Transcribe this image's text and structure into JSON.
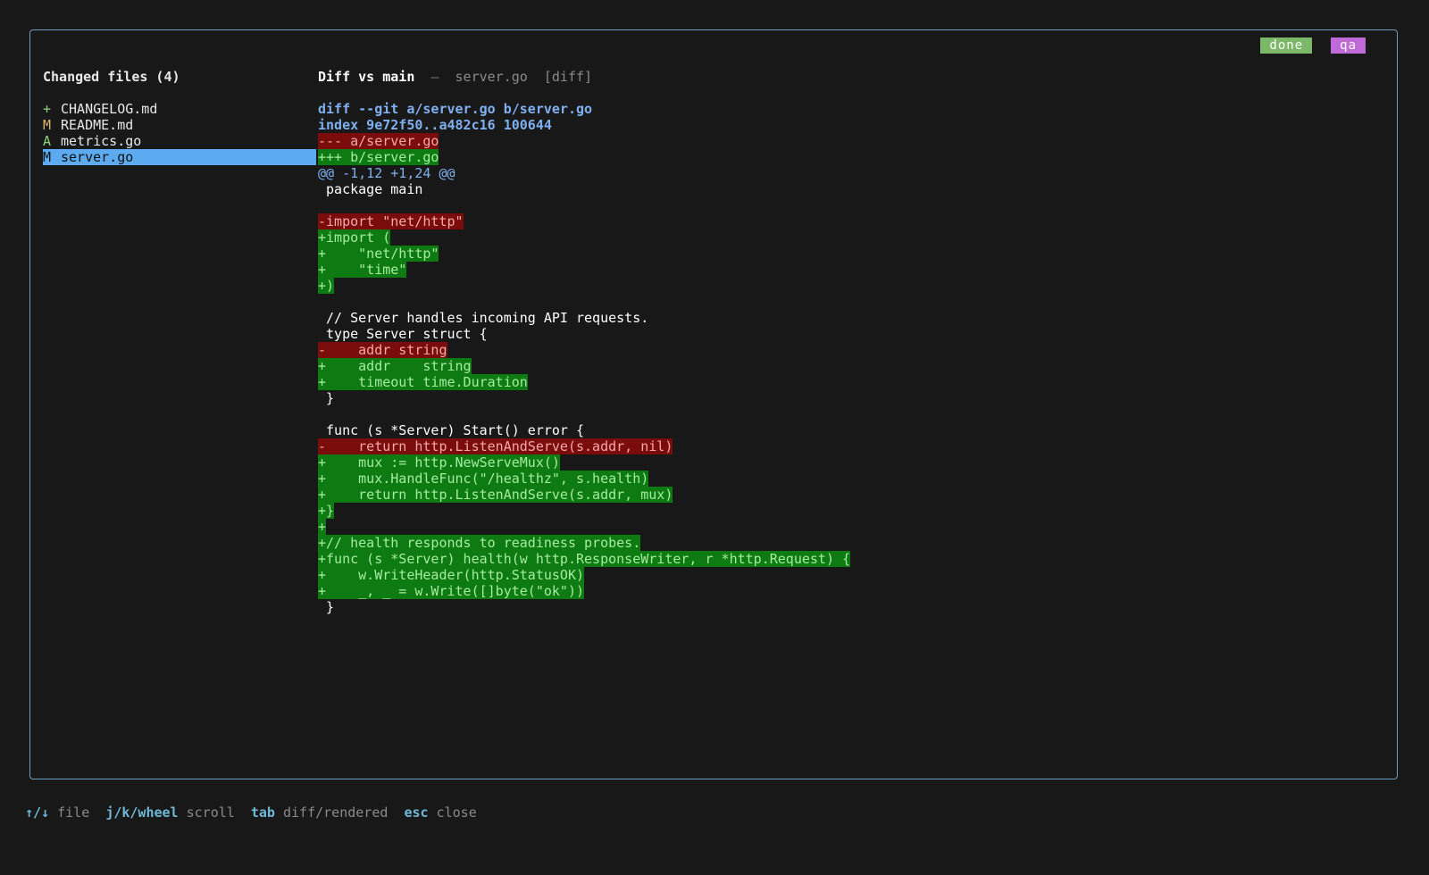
{
  "badges": {
    "done": "done",
    "qa": "qa"
  },
  "sidebar": {
    "title": "Changed files (4)",
    "files": [
      {
        "status": "+",
        "name": "CHANGELOG.md"
      },
      {
        "status": "M",
        "name": "README.md"
      },
      {
        "status": "A",
        "name": "metrics.go"
      },
      {
        "status": "M",
        "name": "server.go"
      }
    ],
    "selected_index": 3
  },
  "header": {
    "title": "Diff vs main",
    "separator": "—",
    "file": "server.go",
    "mode": "[diff]"
  },
  "diff": {
    "lines": [
      {
        "type": "meta",
        "text": "diff --git a/server.go b/server.go"
      },
      {
        "type": "meta",
        "text": "index 9e72f50..a482c16 100644"
      },
      {
        "type": "del",
        "text": "--- a/server.go"
      },
      {
        "type": "add",
        "text": "+++ b/server.go"
      },
      {
        "type": "hunk",
        "text": "@@ -1,12 +1,24 @@"
      },
      {
        "type": "ctx",
        "text": " package main"
      },
      {
        "type": "ctx",
        "text": ""
      },
      {
        "type": "del",
        "text": "-import \"net/http\""
      },
      {
        "type": "add",
        "text": "+import ("
      },
      {
        "type": "add",
        "text": "+    \"net/http\""
      },
      {
        "type": "add",
        "text": "+    \"time\""
      },
      {
        "type": "add",
        "text": "+)"
      },
      {
        "type": "ctx",
        "text": ""
      },
      {
        "type": "ctx",
        "text": " // Server handles incoming API requests."
      },
      {
        "type": "ctx",
        "text": " type Server struct {"
      },
      {
        "type": "del",
        "text": "-    addr string"
      },
      {
        "type": "add",
        "text": "+    addr    string"
      },
      {
        "type": "add",
        "text": "+    timeout time.Duration"
      },
      {
        "type": "ctx",
        "text": " }"
      },
      {
        "type": "ctx",
        "text": ""
      },
      {
        "type": "ctx",
        "text": " func (s *Server) Start() error {"
      },
      {
        "type": "del",
        "text": "-    return http.ListenAndServe(s.addr, nil)"
      },
      {
        "type": "add",
        "text": "+    mux := http.NewServeMux()"
      },
      {
        "type": "add",
        "text": "+    mux.HandleFunc(\"/healthz\", s.health)"
      },
      {
        "type": "add",
        "text": "+    return http.ListenAndServe(s.addr, mux)"
      },
      {
        "type": "add",
        "text": "+}"
      },
      {
        "type": "add",
        "text": "+"
      },
      {
        "type": "add",
        "text": "+// health responds to readiness probes."
      },
      {
        "type": "add",
        "text": "+func (s *Server) health(w http.ResponseWriter, r *http.Request) {"
      },
      {
        "type": "add",
        "text": "+    w.WriteHeader(http.StatusOK)"
      },
      {
        "type": "add",
        "text": "+    _, _ = w.Write([]byte(\"ok\"))"
      },
      {
        "type": "ctx",
        "text": " }"
      }
    ]
  },
  "footer": {
    "items": [
      {
        "key": "↑/↓",
        "desc": "file"
      },
      {
        "key": "j/k/wheel",
        "desc": "scroll"
      },
      {
        "key": "tab",
        "desc": "diff/rendered"
      },
      {
        "key": "esc",
        "desc": "close"
      }
    ]
  },
  "colors": {
    "background": "#181818",
    "border": "#6f9fbe",
    "selected": "#5caaf0",
    "added_bg": "#0d7a12",
    "deleted_bg": "#7a0c0c",
    "meta": "#7fb0f0",
    "done_badge": "#7cb868",
    "qa_badge": "#c06ad8",
    "key": "#6fb8d8"
  }
}
